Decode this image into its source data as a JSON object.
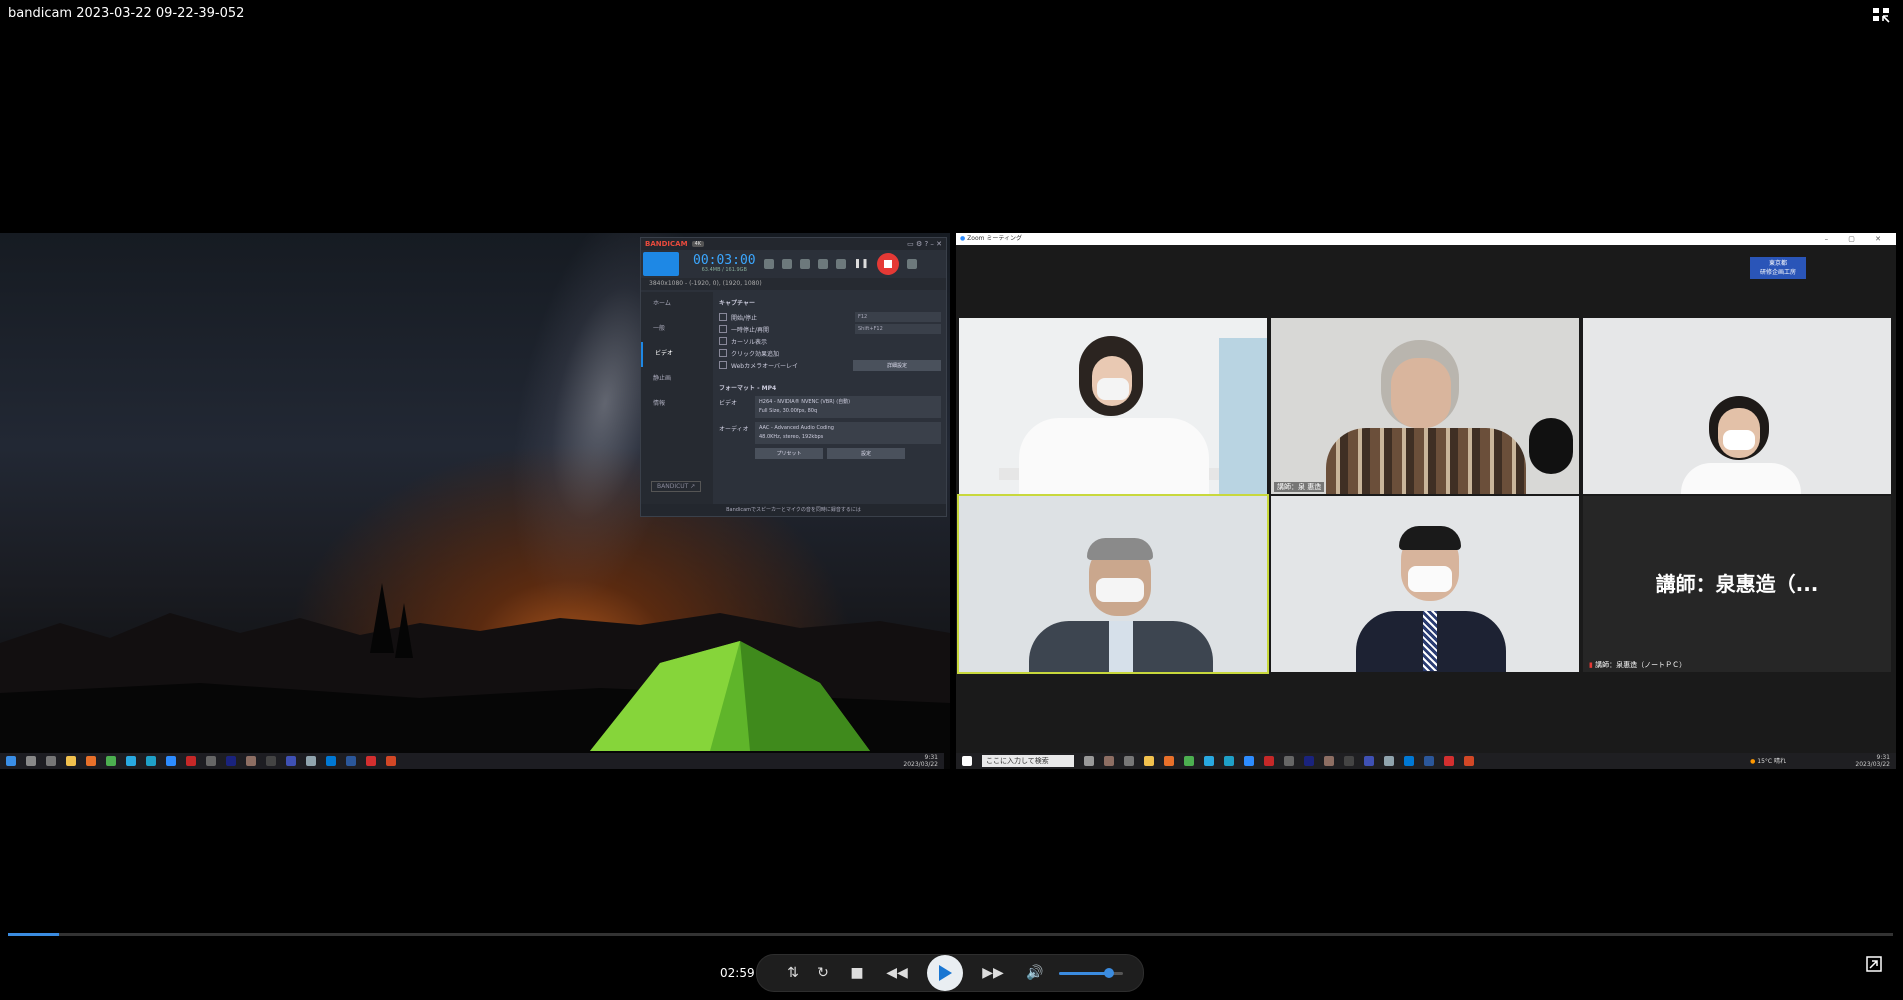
{
  "window": {
    "title": "bandicam 2023-03-22 09-22-39-052"
  },
  "player": {
    "current_time": "02:59",
    "progress_fraction": 0.027,
    "volume_fraction": 0.78
  },
  "left_taskbar": {
    "time": "9:31",
    "date": "2023/03/22"
  },
  "bandicam": {
    "logo_a": "BANDI",
    "logo_b": "CAM",
    "badge": "4K",
    "timer": "00:03:00",
    "size": "63.4MB / 161.9GB",
    "resolution": "3840x1080 - (-1920, 0), (1920, 1080)",
    "side": [
      "ホーム",
      "一般",
      "ビデオ",
      "静止画",
      "情報"
    ],
    "section_capture": "キャプチャー",
    "opts": [
      "開始/停止",
      "一時停止/再開",
      "カーソル表示",
      "クリック効果追加",
      "Webカメラオーバーレイ"
    ],
    "hotkey1": "F12",
    "hotkey2": "Shift+F12",
    "detail_button": "詳細設定",
    "section_format": "フォーマット - MP4",
    "video_label": "ビデオ",
    "video_info1": "H264 - NVIDIA® NVENC (VBR) (自動)",
    "video_info2": "Full Size, 30.00fps, 80q",
    "audio_label": "オーディオ",
    "audio_info1": "AAC - Advanced Audio Coding",
    "audio_info2": "48.0KHz, stereo, 192kbps",
    "preset_button": "プリセット",
    "settings_button": "設定",
    "bandicut": "BANDICUT ↗",
    "footer": "Bandicamでスピーカーとマイクの音を同時に録音するには"
  },
  "zoom": {
    "title": "Zoom ミーティング",
    "badge_line1": "東京都",
    "badge_line2": "研修企画工房",
    "tiles": [
      {
        "name": ""
      },
      {
        "name": "講師：泉 惠造"
      },
      {
        "name": ""
      },
      {
        "name": ""
      },
      {
        "name": ""
      },
      {
        "name": "講師：泉惠造（ノートＰＣ）",
        "big": "講師：泉惠造（..."
      }
    ],
    "search_placeholder": "ここに入力して検索",
    "weather": "15°C 晴れ",
    "clock_time": "9:31",
    "clock_date": "2023/03/22"
  }
}
